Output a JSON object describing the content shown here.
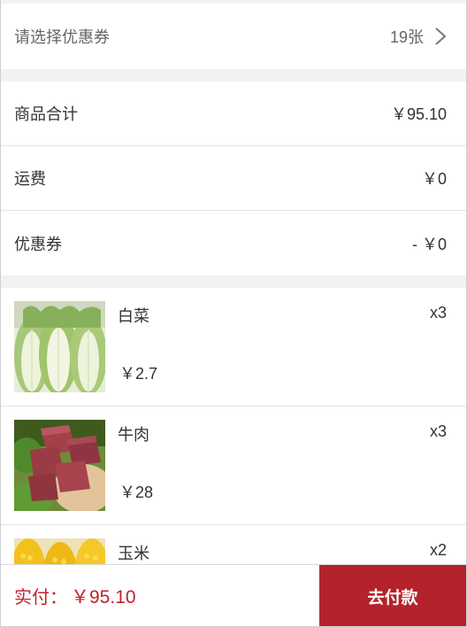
{
  "coupon": {
    "label": "请选择优惠券",
    "count": "19张"
  },
  "summary": [
    {
      "label": "商品合计",
      "value": "￥95.10"
    },
    {
      "label": "运费",
      "value": "￥0"
    },
    {
      "label": "优惠券",
      "value": "- ￥0"
    }
  ],
  "items": [
    {
      "name": "白菜",
      "qty": "x3",
      "price": "￥2.7",
      "image": "napa-cabbage"
    },
    {
      "name": "牛肉",
      "qty": "x3",
      "price": "￥28",
      "image": "beef-cubes"
    },
    {
      "name": "玉米",
      "qty": "x2",
      "price": "",
      "image": "corn"
    }
  ],
  "bottom": {
    "total_label": "实付：",
    "total_value": "￥95.10",
    "pay_label": "去付款"
  },
  "colors": {
    "accent": "#b4232c",
    "price_red": "#c0222b",
    "divider": "#f2f2f2"
  }
}
